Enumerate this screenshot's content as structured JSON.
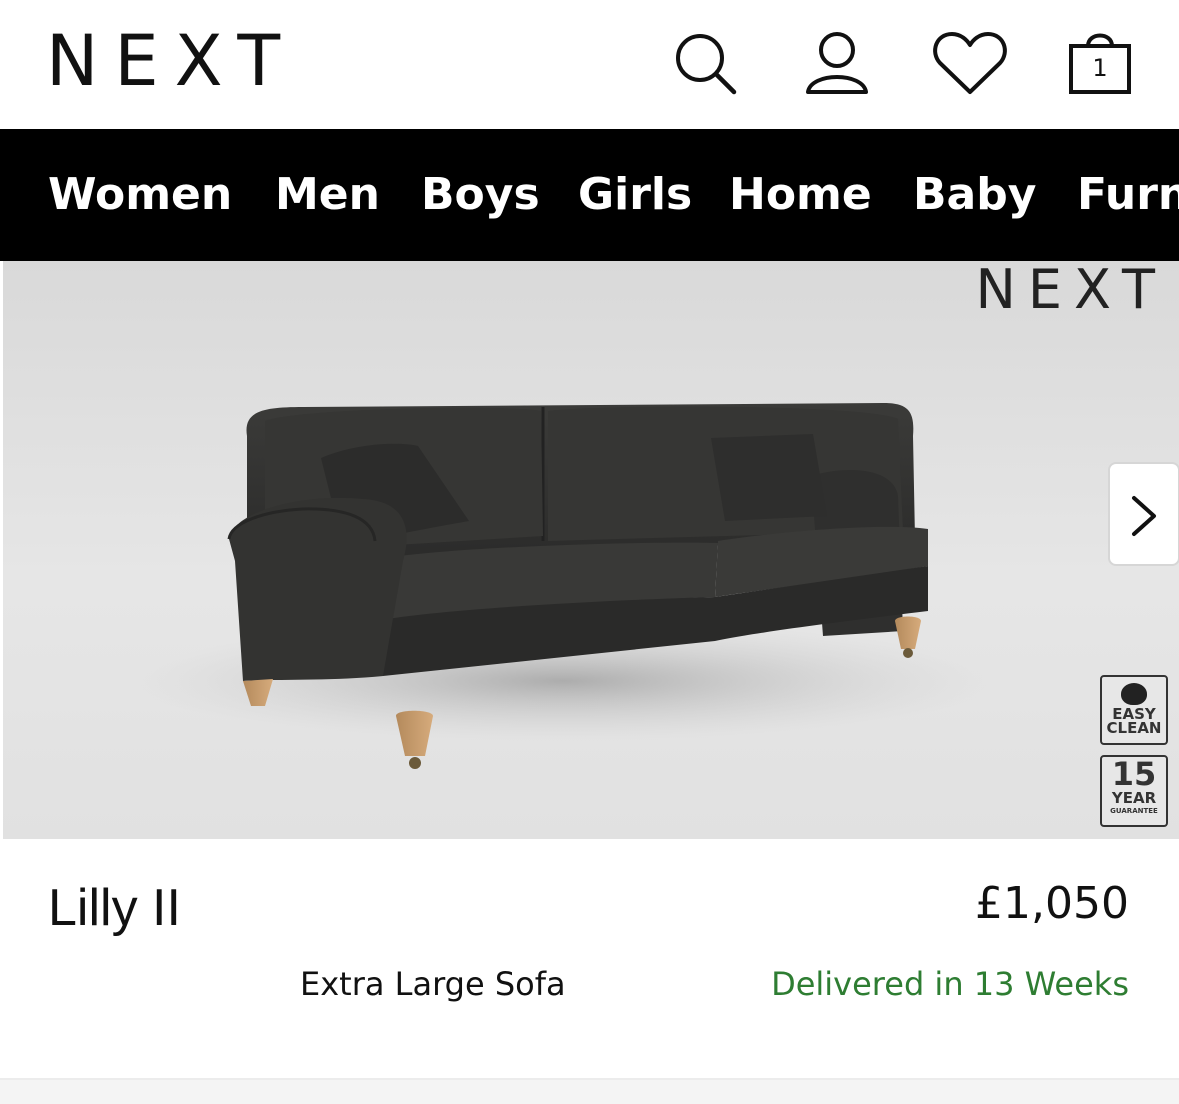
{
  "header": {
    "logo": "NEXT",
    "bag_count": "1"
  },
  "nav": {
    "items": [
      "Women",
      "Men",
      "Boys",
      "Girls",
      "Home",
      "Baby",
      "Furn"
    ]
  },
  "hero": {
    "watermark_logo": "NEXT",
    "badges": {
      "easy_clean": [
        "EASY",
        "CLEAN"
      ],
      "guarantee": [
        "15",
        "YEAR",
        "GUARANTEE"
      ]
    }
  },
  "product": {
    "name": "Lilly II",
    "price": "£1,050",
    "subtitle": "Extra Large Sofa",
    "delivery": "Delivered in 13 Weeks"
  },
  "colors": {
    "delivery_green": "#2e7d32",
    "nav_bg": "#000000"
  }
}
